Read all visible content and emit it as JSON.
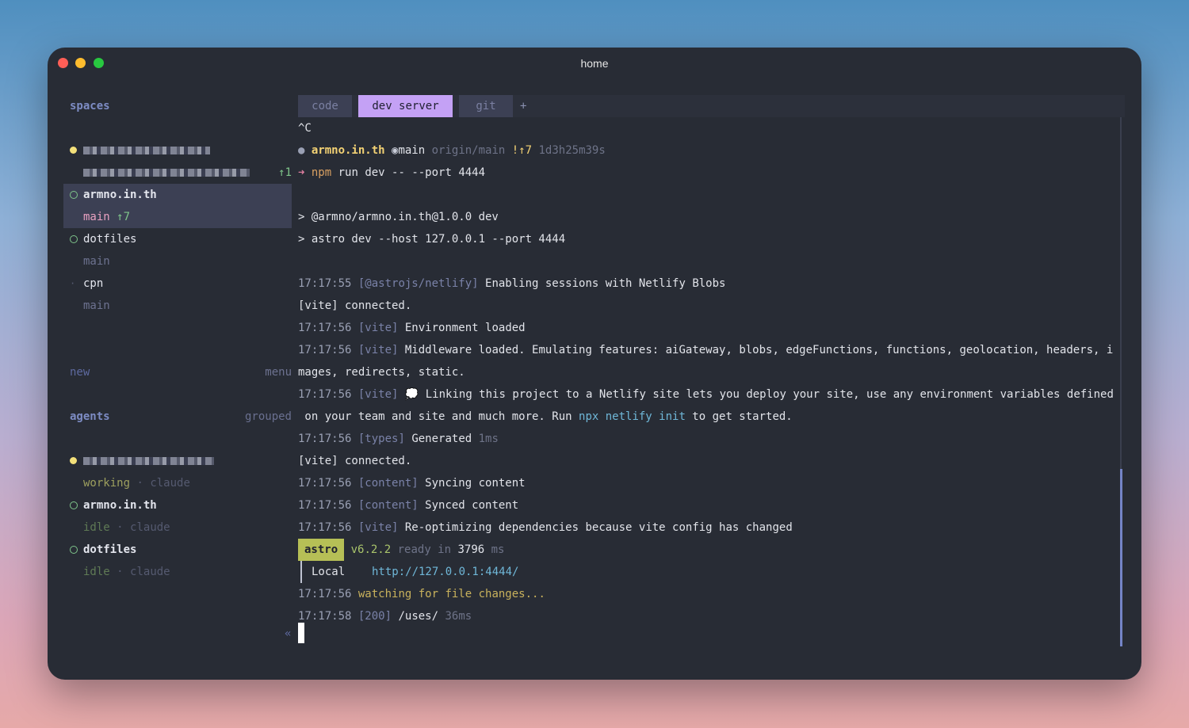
{
  "window": {
    "title": "home"
  },
  "sidebar": {
    "spaces_header": "spaces",
    "spaces": [
      {
        "name": "armno.in.th",
        "branch": "main",
        "ahead": "↑7"
      },
      {
        "name": "dotfiles",
        "branch": "main"
      },
      {
        "name": "cpn",
        "branch": "main"
      }
    ],
    "first_ahead": "↑1",
    "new_label": "new",
    "menu_label": "menu",
    "agents_header": "agents",
    "grouped_label": "grouped",
    "agents": [
      {
        "status": "working",
        "tool": "claude"
      },
      {
        "name": "armno.in.th",
        "status": "idle",
        "tool": "claude"
      },
      {
        "name": "dotfiles",
        "status": "idle",
        "tool": "claude"
      }
    ],
    "separator": "·",
    "collapse_glyph": "«"
  },
  "tabs": {
    "items": [
      "code",
      "dev server",
      "git"
    ],
    "add": "+"
  },
  "terminal": {
    "ctrl_c": "^C",
    "prompt": {
      "path": "armno.in.th",
      "branch": "main",
      "remote": "origin/main",
      "status": "!↑7",
      "duration": "1d3h25m39s",
      "arrow": "➜",
      "cmd_npm": "npm",
      "cmd_rest": " run dev -- --port 4444"
    },
    "pkg_line": "> @armno/armno.in.th@1.0.0 dev",
    "astro_cmd": "> astro dev --host 127.0.0.1 --port 4444",
    "logs": [
      {
        "ts": "17:17:55",
        "tag": "[@astrojs/netlify]",
        "msg": " Enabling sessions with Netlify Blobs"
      },
      {
        "plain": "[vite] connected."
      },
      {
        "ts": "17:17:56",
        "tag": "[vite]",
        "msg": " Environment loaded"
      },
      {
        "ts": "17:17:56",
        "tag": "[vite]",
        "msg": " Middleware loaded. Emulating features: aiGateway, blobs, edgeFunctions, functions, geolocation, headers, i"
      },
      {
        "plain": "mages, redirects, static."
      },
      {
        "ts": "17:17:56",
        "tag": "[vite]",
        "msg": " 💭 Linking this project to a Netlify site lets you deploy your site, use any environment variables defined"
      }
    ],
    "wrap_pre": " on your team and site and much more. Run ",
    "wrap_cmd": "npx netlify init",
    "wrap_post": " to get started.",
    "logs2": [
      {
        "ts": "17:17:56",
        "tag": "[types]",
        "msg": " Generated ",
        "extra": "1ms"
      },
      {
        "plain": "[vite] connected."
      },
      {
        "ts": "17:17:56",
        "tag": "[content]",
        "msg": " Syncing content"
      },
      {
        "ts": "17:17:56",
        "tag": "[content]",
        "msg": " Synced content"
      },
      {
        "ts": "17:17:56",
        "tag": "[vite]",
        "msg": " Re-optimizing dependencies because vite config has changed"
      }
    ],
    "ready": {
      "badge": "astro",
      "version": "v6.2.2",
      "ready_word": " ready in ",
      "time": "3796",
      "unit": " ms"
    },
    "local": {
      "label": "Local",
      "url": "http://127.0.0.1:4444/"
    },
    "watching": {
      "ts": "17:17:56",
      "msg": " watching for file changes..."
    },
    "last": {
      "ts": "17:17:58",
      "tag": "[200]",
      "path": " /uses/ ",
      "ms": "36ms"
    }
  }
}
